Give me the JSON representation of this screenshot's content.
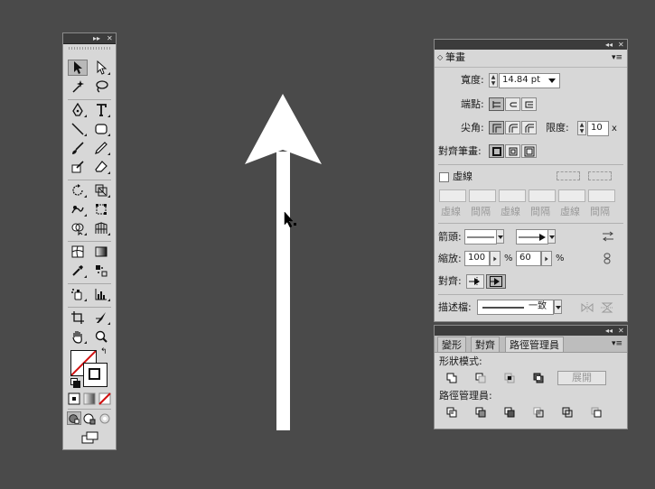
{
  "tools_panel": {
    "header_expand": "▸▸",
    "header_close": "✕"
  },
  "stroke_panel": {
    "title": "筆畫",
    "collapse_arrow": "◂◂",
    "close_glyph": "✕",
    "menu_glyph": "▾≡",
    "weight_label": "寬度:",
    "weight_value": "14.84 pt",
    "cap_label": "端點:",
    "corner_label": "尖角:",
    "limit_label": "限度:",
    "limit_value": "10",
    "limit_unit": "x",
    "align_label": "對齊筆畫:",
    "dashed_label": "虛線",
    "dashed_checked": false,
    "dash_fields": [
      "虛線",
      "間隔",
      "虛線",
      "間隔",
      "虛線",
      "間隔"
    ],
    "arrowheads_label": "箭頭:",
    "scale_label": "縮放:",
    "scale_start": "100",
    "scale_end": "60",
    "percent": "%",
    "arrow_align_label": "對齊:",
    "profile_label": "描述檔:",
    "profile_value": "一致"
  },
  "pathfinder_panel": {
    "tabs": [
      "變形",
      "對齊",
      "路徑管理員"
    ],
    "active_tab": "路徑管理員",
    "collapse_arrow": "◂◂",
    "close_glyph": "✕",
    "menu_glyph": "▾≡",
    "shape_modes_label": "形狀模式:",
    "expand_button": "展開",
    "pathfinders_label": "路徑管理員:"
  },
  "canvas": {
    "background": "#4a4a4a",
    "arrow_color": "#ffffff"
  }
}
